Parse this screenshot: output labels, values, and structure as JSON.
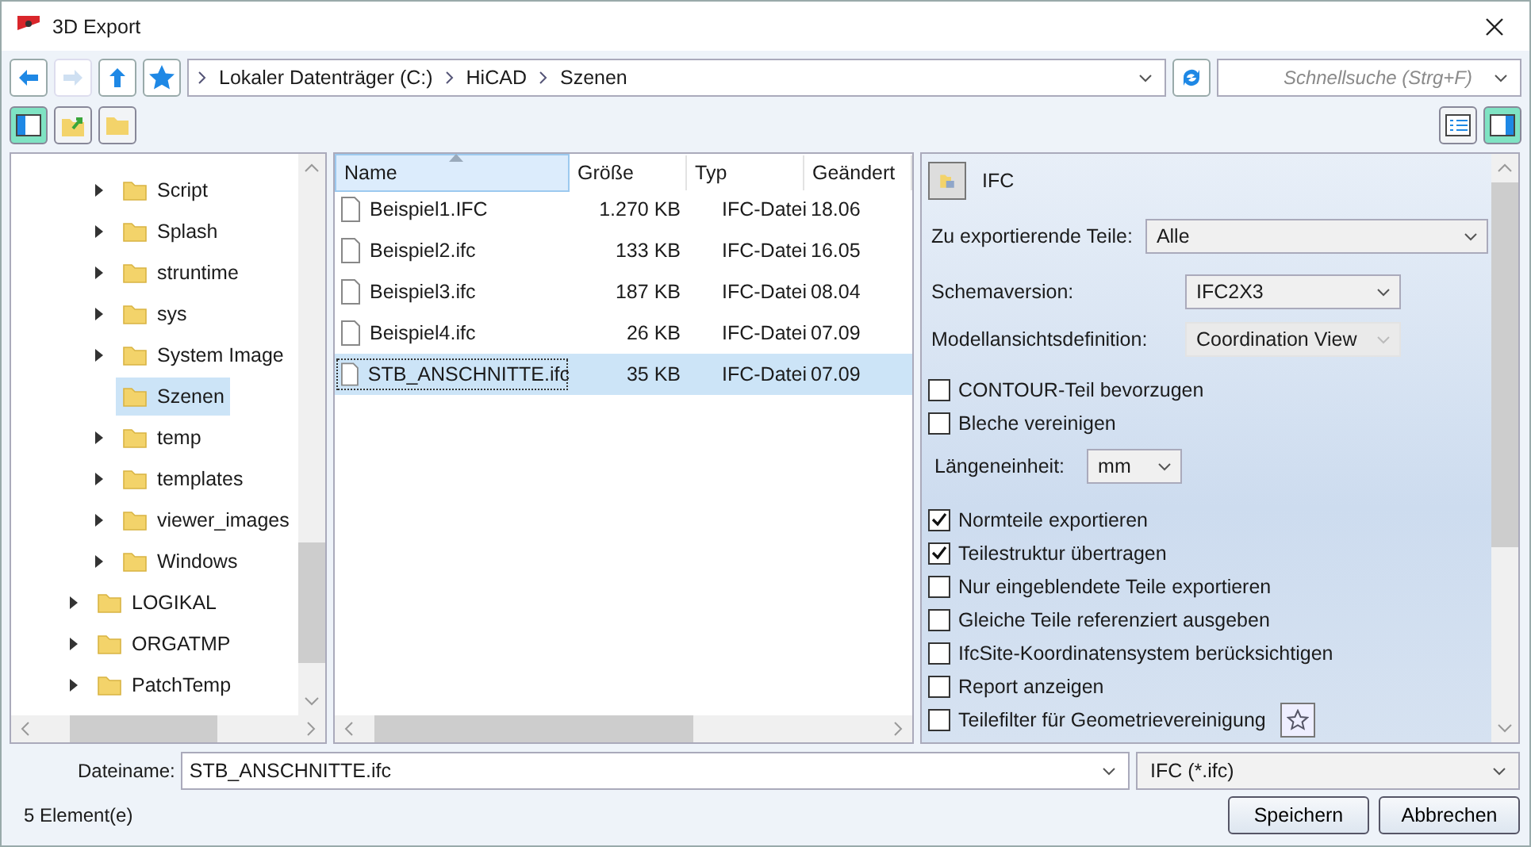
{
  "window": {
    "title": "3D Export"
  },
  "nav": {
    "buttons": [
      {
        "kind": "back",
        "disabled": false
      },
      {
        "kind": "forward",
        "disabled": true
      },
      {
        "kind": "up",
        "disabled": false
      },
      {
        "kind": "favorites",
        "disabled": false
      }
    ],
    "breadcrumb": [
      "Lokaler Datenträger (C:)",
      "HiCAD",
      "Szenen"
    ],
    "search": {
      "placeholder": "Schnellsuche (Strg+F)"
    }
  },
  "toolbar": {
    "left": [
      {
        "kind": "pane",
        "on": true
      },
      {
        "kind": "new-folder",
        "on": false
      },
      {
        "kind": "folder",
        "on": false
      }
    ],
    "right": [
      {
        "kind": "details",
        "on": false
      },
      {
        "kind": "preview",
        "on": true
      }
    ]
  },
  "tree": {
    "items": [
      {
        "children": [
          {
            "label": "Script",
            "expandable": true,
            "selected": false
          },
          {
            "label": "Splash",
            "expandable": true,
            "selected": false
          },
          {
            "label": "struntime",
            "expandable": true,
            "selected": false
          },
          {
            "label": "sys",
            "expandable": true,
            "selected": false
          },
          {
            "label": "System Image",
            "expandable": true,
            "selected": false
          },
          {
            "label": "Szenen",
            "expandable": false,
            "selected": true
          },
          {
            "label": "temp",
            "expandable": true,
            "selected": false
          },
          {
            "label": "templates",
            "expandable": true,
            "selected": false
          },
          {
            "label": "viewer_images",
            "expandable": true,
            "selected": false
          },
          {
            "label": "Windows",
            "expandable": true,
            "selected": false
          }
        ]
      },
      {
        "label": "LOGIKAL",
        "expandable": true,
        "selected": false
      },
      {
        "label": "ORGATMP",
        "expandable": true,
        "selected": false
      },
      {
        "label": "PatchTemp",
        "expandable": true,
        "selected": false
      }
    ]
  },
  "files": {
    "columns": [
      "Name",
      "Größe",
      "Typ",
      "Geändert"
    ],
    "rows": [
      {
        "name": "Beispiel1.IFC",
        "size": "1.270 KB",
        "type": "IFC-Datei",
        "date": "18.06",
        "selected": false
      },
      {
        "name": "Beispiel2.ifc",
        "size": "133 KB",
        "type": "IFC-Datei",
        "date": "16.05",
        "selected": false
      },
      {
        "name": "Beispiel3.ifc",
        "size": "187 KB",
        "type": "IFC-Datei",
        "date": "08.04",
        "selected": false
      },
      {
        "name": "Beispiel4.ifc",
        "size": "26 KB",
        "type": "IFC-Datei",
        "date": "07.09",
        "selected": false
      },
      {
        "name": "STB_ANSCHNITTE.ifc",
        "size": "35 KB",
        "type": "IFC-Datei",
        "date": "07.09",
        "selected": true
      }
    ]
  },
  "options": {
    "title": "IFC",
    "fields": [
      {
        "kind": "select-wide",
        "label": "Zu exportierende Teile:",
        "value": "Alle",
        "disabled": false
      },
      {
        "kind": "select",
        "label": "Schemaversion:",
        "value": "IFC2X3",
        "disabled": false
      },
      {
        "kind": "select",
        "label": "Modellansichtsdefinition:",
        "value": "Coordination View",
        "disabled": true
      },
      {
        "kind": "checkbox",
        "label": "CONTOUR-Teil bevorzugen",
        "checked": false
      },
      {
        "kind": "checkbox",
        "label": "Bleche vereinigen",
        "checked": false
      },
      {
        "kind": "unit",
        "label": "Längeneinheit:",
        "value": "mm"
      },
      {
        "kind": "checkbox",
        "label": "Normteile exportieren",
        "checked": true
      },
      {
        "kind": "checkbox",
        "label": "Teilestruktur übertragen",
        "checked": true
      },
      {
        "kind": "checkbox",
        "label": "Nur eingeblendete Teile exportieren",
        "checked": false
      },
      {
        "kind": "checkbox",
        "label": "Gleiche Teile referenziert ausgeben",
        "checked": false
      },
      {
        "kind": "checkbox",
        "label": "IfcSite-Koordinatensystem berücksichtigen",
        "checked": false
      },
      {
        "kind": "checkbox",
        "label": "Report anzeigen",
        "checked": false
      },
      {
        "kind": "checkbox-star",
        "label": "Teilefilter für Geometrievereinigung",
        "checked": false
      }
    ]
  },
  "footer": {
    "filename_label": "Dateiname:",
    "filename": "STB_ANSCHNITTE.ifc",
    "filetype": "IFC (*.ifc)",
    "status": "5 Element(e)",
    "buttons": [
      "Speichern",
      "Abbrechen"
    ]
  }
}
